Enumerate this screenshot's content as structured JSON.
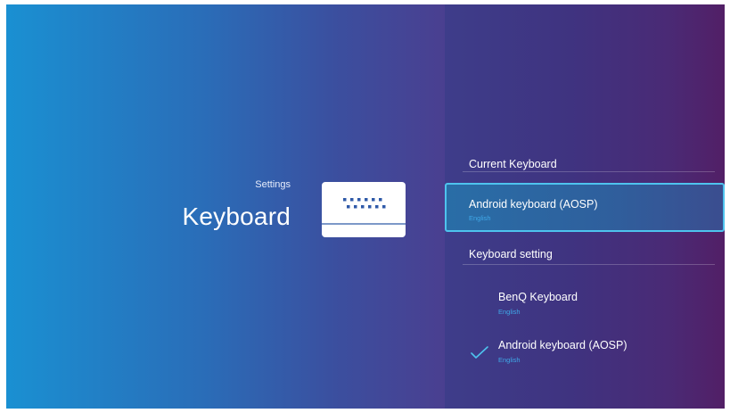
{
  "header": {
    "breadcrumb": "Settings",
    "title": "Keyboard",
    "icon": "keyboard-icon"
  },
  "current_keyboard": {
    "section_label": "Current Keyboard",
    "selected": {
      "label": "Android keyboard (AOSP)",
      "sublabel": "English"
    }
  },
  "keyboard_setting": {
    "section_label": "Keyboard setting",
    "options": [
      {
        "label": "BenQ Keyboard",
        "sublabel": "English",
        "checked": false
      },
      {
        "label": "Android keyboard (AOSP)",
        "sublabel": "English",
        "checked": true,
        "icon": "check-icon"
      }
    ]
  },
  "colors": {
    "focus_border": "#4ec3ee",
    "sublabel": "#3fa8e8",
    "check": "#4ec3ee"
  }
}
